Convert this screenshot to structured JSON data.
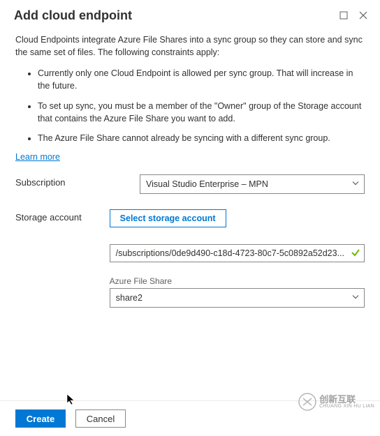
{
  "header": {
    "title": "Add cloud endpoint"
  },
  "intro": "Cloud Endpoints integrate Azure File Shares into a sync group so they can store and sync the same set of files. The following constraints apply:",
  "constraints": [
    "Currently only one Cloud Endpoint is allowed per sync group. That will increase in the future.",
    "To set up sync, you must be a member of the \"Owner\" group of the Storage account that contains the Azure File Share you want to add.",
    "The Azure File Share cannot already be syncing with a different sync group."
  ],
  "learn_more": "Learn more",
  "form": {
    "subscription_label": "Subscription",
    "subscription_value": "Visual Studio Enterprise – MPN",
    "storage_account_label": "Storage account",
    "select_storage_btn": "Select storage account",
    "storage_path": "/subscriptions/0de9d490-c18d-4723-80c7-5c0892a52d23...",
    "file_share_label": "Azure File Share",
    "file_share_value": "share2"
  },
  "footer": {
    "create": "Create",
    "cancel": "Cancel"
  },
  "watermark": {
    "line1": "创新互联",
    "line2": "CHUANG XIN HU LIAN"
  }
}
